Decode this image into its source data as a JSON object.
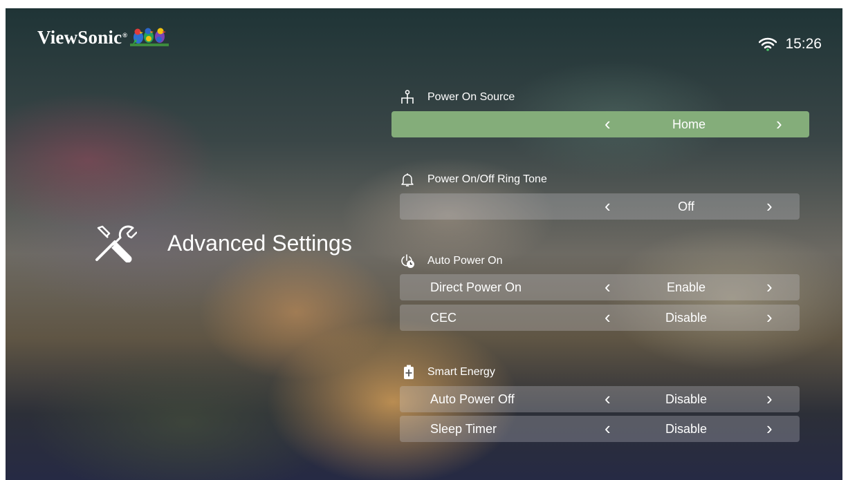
{
  "brand": {
    "name": "ViewSonic",
    "reg": "®"
  },
  "status": {
    "time": "15:26"
  },
  "side": {
    "title": "Advanced Settings"
  },
  "arrows": {
    "prev": "‹",
    "next": "›"
  },
  "sections": {
    "power_on_source": {
      "title": "Power On Source",
      "icon": "source-icon",
      "rows": [
        {
          "label": "",
          "value": "Home",
          "focused": true
        }
      ]
    },
    "ring_tone": {
      "title": "Power On/Off Ring Tone",
      "icon": "bell-icon",
      "rows": [
        {
          "label": "",
          "value": "Off"
        }
      ]
    },
    "auto_power_on": {
      "title": "Auto Power On",
      "icon": "power-clock-icon",
      "rows": [
        {
          "label": "Direct Power On",
          "value": "Enable"
        },
        {
          "label": "CEC",
          "value": "Disable"
        }
      ]
    },
    "smart_energy": {
      "title": "Smart Energy",
      "icon": "battery-icon",
      "rows": [
        {
          "label": "Auto Power Off",
          "value": "Disable"
        },
        {
          "label": "Sleep Timer",
          "value": "Disable"
        }
      ]
    }
  },
  "colors": {
    "focus": "#84ad7a",
    "row": "rgba(210,210,215,0.28)",
    "text": "#ffffff"
  }
}
